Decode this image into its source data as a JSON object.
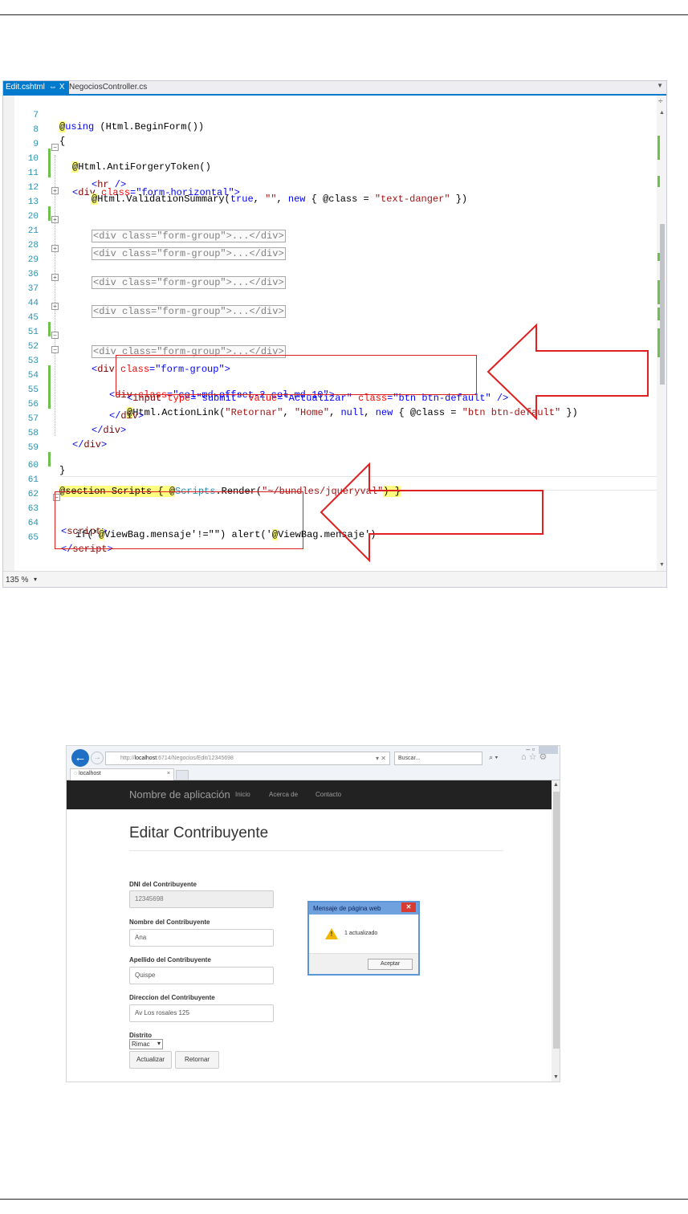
{
  "editor": {
    "tabs": [
      {
        "label": "Edit.cshtml",
        "pin": "⇔",
        "close": "X"
      },
      {
        "label": "NegociosController.cs"
      }
    ],
    "zoom": "135 %",
    "lines": {
      "l7": {
        "num": "7",
        "kw": "using",
        "rest": " (Html.BeginForm())"
      },
      "l8": {
        "num": "8",
        "text": "{"
      },
      "l9": {
        "num": "9",
        "text": "Html.AntiForgeryToken()"
      },
      "l10": {
        "num": "10",
        "tag": "div",
        "attr": "class",
        "val": "\"form-horizontal\""
      },
      "l11": {
        "num": "11",
        "tag": "hr",
        "end": " />"
      },
      "l12": {
        "num": "12",
        "a": "Html.ValidationSummary(",
        "b": "true",
        "c": ", ",
        "d": "\"\"",
        "e": ", ",
        "f": "new",
        "g": " { @class = ",
        "h": "\"text-danger\"",
        "i": " })"
      },
      "l13": {
        "num": "13",
        "collapsed": "<div class=\"form-group\">...</div>"
      },
      "l20": {
        "num": "20"
      },
      "l21": {
        "num": "21",
        "collapsed": "<div class=\"form-group\">...</div>"
      },
      "l28": {
        "num": "28"
      },
      "l29": {
        "num": "29",
        "collapsed": "<div class=\"form-group\">...</div>"
      },
      "l36": {
        "num": "36"
      },
      "l37": {
        "num": "37",
        "collapsed": "<div class=\"form-group\">...</div>"
      },
      "l44": {
        "num": "44"
      },
      "l45": {
        "num": "45",
        "collapsed": "<div class=\"form-group\">...</div>"
      },
      "l51": {
        "num": "51"
      },
      "l52": {
        "num": "52",
        "tag": "div",
        "attr": "class",
        "val": "\"form-group\""
      },
      "l53": {
        "num": "53",
        "tag": "div",
        "attr": "class",
        "val": "\"col-md-offset-2 col-md-10\""
      },
      "l54": {
        "num": "54",
        "tag": "input",
        "a1": "type",
        "v1": "\"submit\"",
        "a2": "value",
        "v2": "\"Actualizar\"",
        "a3": "class",
        "v3": "\"btn btn-default\"",
        "end": " />"
      },
      "l55": {
        "num": "55",
        "a": "Html.ActionLink(",
        "b": "\"Retornar\"",
        "c": ", ",
        "d": "\"Home\"",
        "e": ", ",
        "f": "null",
        "g": ", ",
        "h": "new",
        "i": " { @class = ",
        "j": "\"btn btn-default\"",
        "k": " })"
      },
      "l56": {
        "num": "56",
        "tag": "div"
      },
      "l57": {
        "num": "57",
        "tag": "div"
      },
      "l58": {
        "num": "58",
        "tag": "div"
      },
      "l59": {
        "num": "59",
        "text": "}"
      },
      "l60": {
        "num": "60"
      },
      "l61": {
        "num": "61",
        "a": "section Scripts { ",
        "b": "Scripts",
        "c": ".Render(",
        "d": "\"~/bundles/jqueryval\"",
        "e": ") }"
      },
      "l62": {
        "num": "62"
      },
      "l63": {
        "num": "63",
        "tag": "script"
      },
      "l64": {
        "num": "64",
        "a": "if('",
        "b": "ViewBag.mensaje",
        "c": "'!=\"\") alert('",
        "d": "ViewBag.mensaje",
        "e": "')"
      },
      "l65": {
        "num": "65",
        "tag": "script"
      }
    }
  },
  "browser": {
    "address": {
      "prefix": "http://",
      "domain": "localhost",
      "path": ":6714/Negocios/Edit/12345698",
      "tools": "▾ ✕"
    },
    "search": "Buscar...",
    "tab_title": "localhost",
    "tab_close": "×",
    "brand": "Nombre de aplicación",
    "nav": [
      "Inicio",
      "Acerca de",
      "Contacto"
    ],
    "page_title": "Editar Contribuyente",
    "fields": [
      {
        "label": "DNI del Contribuyente",
        "value": "12345698"
      },
      {
        "label": "Nombre del Contribuyente",
        "value": "Ana"
      },
      {
        "label": "Apellido del Contribuyente",
        "value": "Quispe"
      },
      {
        "label": "Direccion del Contribuyente",
        "value": "Av Los rosales 125"
      }
    ],
    "district_label": "Distrito",
    "district_value": "Rimac",
    "buttons": {
      "update": "Actualizar",
      "back": "Retornar"
    },
    "dialog": {
      "title": "Mensaje de página web",
      "close": "✕",
      "message": "1 actualizado",
      "ok": "Aceptar"
    },
    "window_controls": "–  ▫"
  },
  "colors": {
    "arrow": "#e02020",
    "vs_accent": "#007acc",
    "navbar": "#222222"
  }
}
